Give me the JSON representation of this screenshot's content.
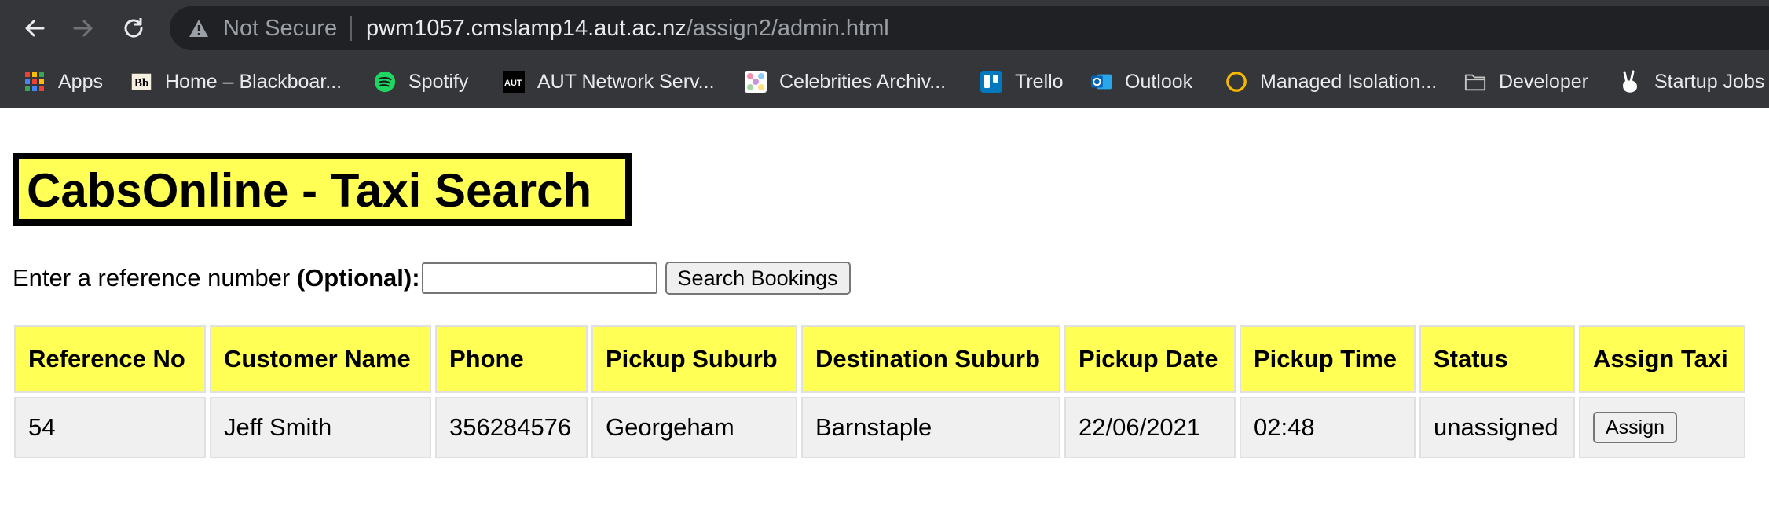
{
  "browser": {
    "security_label": "Not Secure",
    "url_host": "pwm1057.cmslamp14.aut.ac.nz",
    "url_path": "/assign2/admin.html"
  },
  "bookmarks": [
    {
      "label": "Apps",
      "icon": "apps-grid-icon"
    },
    {
      "label": "Home – Blackboar...",
      "icon": "blackboard-icon"
    },
    {
      "label": "Spotify",
      "icon": "spotify-icon"
    },
    {
      "label": "AUT Network Serv...",
      "icon": "aut-icon"
    },
    {
      "label": "Celebrities Archiv...",
      "icon": "celebrities-icon"
    },
    {
      "label": "Trello",
      "icon": "trello-icon"
    },
    {
      "label": "Outlook",
      "icon": "outlook-icon"
    },
    {
      "label": "Managed Isolation...",
      "icon": "circle-icon"
    },
    {
      "label": "Developer",
      "icon": "folder-icon"
    },
    {
      "label": "Startup Jobs",
      "icon": "peace-hand-icon"
    }
  ],
  "page": {
    "title": "CabsOnline - Taxi Search",
    "search_label": "Enter a reference number ",
    "search_label_bold": "(Optional):",
    "search_value": "",
    "search_button": "Search Bookings"
  },
  "table": {
    "headers": [
      "Reference No",
      "Customer Name",
      "Phone",
      "Pickup Suburb",
      "Destination Suburb",
      "Pickup Date",
      "Pickup Time",
      "Status",
      "Assign Taxi"
    ],
    "rows": [
      {
        "reference": "54",
        "customer": "Jeff Smith",
        "phone": "356284576",
        "pickup_suburb": "Georgeham",
        "destination_suburb": "Barnstaple",
        "pickup_date": "22/06/2021",
        "pickup_time": "02:48",
        "status": "unassigned",
        "assign_label": "Assign"
      }
    ]
  },
  "colors": {
    "header_yellow": "#ffff55",
    "cell_gray": "#f0f0f0",
    "chrome_dark": "#35363a"
  }
}
